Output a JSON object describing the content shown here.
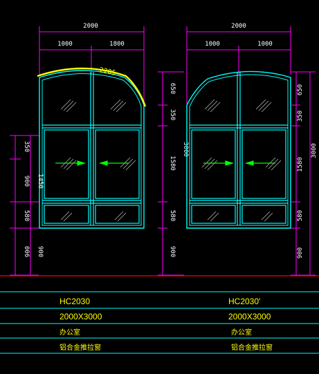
{
  "left_window": {
    "overall_width": "2000",
    "sub_width_a": "1000",
    "sub_width_b": "1800",
    "arc_length": "2205",
    "left_dims": [
      "350",
      "900",
      "1450",
      "580",
      "006",
      "900"
    ],
    "right_dims": [
      "650",
      "350",
      "1580",
      "580",
      "900"
    ],
    "total_height": "3000"
  },
  "right_window": {
    "overall_width": "2000",
    "sub_width_a": "1000",
    "sub_width_b": "1000",
    "left_dims": [
      "650",
      "350",
      "1580",
      "580",
      "900"
    ],
    "right_dims": [
      "650",
      "350",
      "1580",
      "580",
      "900"
    ],
    "total_height": "3000"
  },
  "table": {
    "left": {
      "code": "HC2030",
      "size": "2000X3000",
      "room": "办公室",
      "type": "铝合金推拉窗"
    },
    "right": {
      "code": "HC2030'",
      "size": "2000X3000",
      "room": "办公室",
      "type": "铝合金推拉窗"
    }
  },
  "colors": {
    "frame": "#00ffff",
    "dimension": "#ff00ff",
    "highlight": "#ffff00",
    "arrow": "#00ff00",
    "floor": "#ff0000"
  }
}
